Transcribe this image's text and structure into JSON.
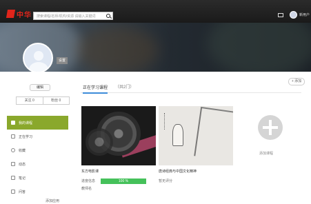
{
  "header": {
    "logo_text": "中华",
    "search_placeholder": "搜索课程/名师/机构/资源 请输入关键词",
    "user_name": "新用户"
  },
  "profile": {
    "settings_label": "设置",
    "edit_label": "编辑",
    "counts": [
      "关注 0",
      "粉丝 0"
    ]
  },
  "sidebar": {
    "items": [
      {
        "label": "我的课程"
      },
      {
        "label": "正在学习"
      },
      {
        "label": "收藏"
      },
      {
        "label": "动态"
      },
      {
        "label": "笔记"
      },
      {
        "label": "问答"
      }
    ],
    "bottom_link": "添加应用"
  },
  "main": {
    "tab_active": "正在学习课程",
    "tab_count": "（共2门）",
    "add_label": "+ 添加",
    "courses": [
      {
        "title": "东方电影课",
        "progress_text": "进度信息",
        "percent": 100,
        "percent_label": "100 %",
        "meta": "教师名"
      },
      {
        "title": "唐诗经典与中国文化精神",
        "meta": "暂无评分"
      }
    ],
    "add_course_label": "添加课程"
  }
}
